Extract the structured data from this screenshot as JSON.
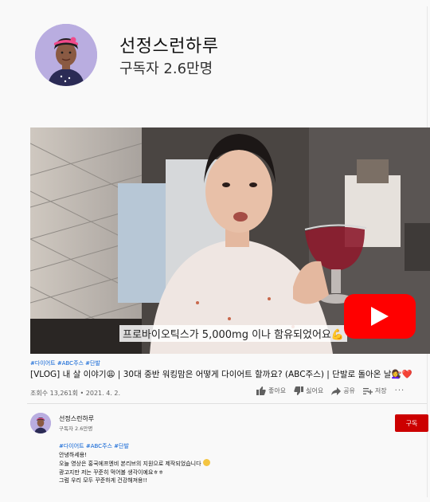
{
  "channel": {
    "name": "선정스런하루",
    "subscribers": "구독자 2.6만명"
  },
  "video": {
    "caption": "프로바이오틱스가 5,000mg 이나 함유되었어요💪",
    "tags": "#다이어트 #ABC주스 #단발",
    "title": "[VLOG] 내 살 이야기😩 | 30대 중반 워킹맘은 어떻게 다이어트 할까요? (ABC주스) | 단발로 돌아온 날💇‍♀️❤️",
    "meta": "조회수 13,261회 • 2021. 4. 2."
  },
  "actions": {
    "like": "좋아요",
    "dislike": "싫어요",
    "share": "공유",
    "save": "저장",
    "more": "···"
  },
  "owner": {
    "name": "선정스런하루",
    "subscribers": "구독자 2.6만명",
    "subscribe_label": "구독"
  },
  "description": {
    "tags": "#다이어트 #ABC주스 #단발",
    "line1": "안녕하세용!",
    "line2": "오늘 영상은 홍국에프엔비 본리브의 지원으로 제작되었습니다",
    "line3": "광고지만 저는 꾸준히 먹어볼 생각이예요ㅎㅎ",
    "line4": "그럼 우리 모두 꾸준하게 건강해져용!!"
  },
  "colors": {
    "brand_red": "#ff0000",
    "subscribe_red": "#cc0000",
    "link_blue": "#065fd4"
  }
}
